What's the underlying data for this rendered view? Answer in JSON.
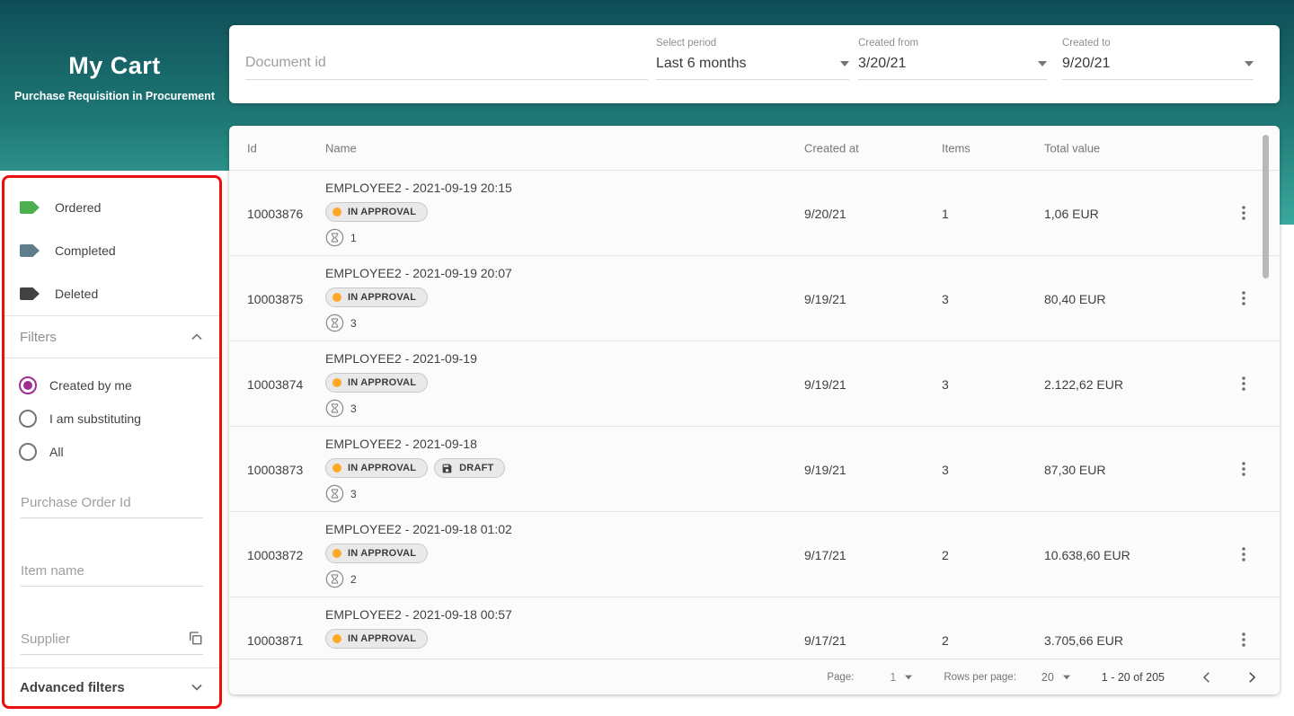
{
  "app": {
    "title": "My Cart",
    "subtitle": "Purchase Requisition in Procurement"
  },
  "sidebar": {
    "statuses": [
      {
        "label": "Ordered",
        "color": "#4caf50",
        "icon": "tag-icon"
      },
      {
        "label": "Completed",
        "color": "#607d8b",
        "icon": "tag-icon"
      },
      {
        "label": "Deleted",
        "color": "#424242",
        "icon": "tag-icon"
      }
    ],
    "filters_header": "Filters",
    "radios": [
      {
        "label": "Created by me",
        "selected": true
      },
      {
        "label": "I am substituting",
        "selected": false
      },
      {
        "label": "All",
        "selected": false
      }
    ],
    "inputs": [
      {
        "name": "purchase-order-id",
        "placeholder": "Purchase Order Id",
        "icon": null
      },
      {
        "name": "item-name",
        "placeholder": "Item name",
        "icon": null
      },
      {
        "name": "supplier",
        "placeholder": "Supplier",
        "icon": "copy-icon"
      }
    ],
    "advanced_filters_label": "Advanced filters"
  },
  "topbar": {
    "document_id_placeholder": "Document id",
    "select_period": {
      "label": "Select period",
      "value": "Last 6 months"
    },
    "created_from": {
      "label": "Created from",
      "value": "3/20/21"
    },
    "created_to": {
      "label": "Created to",
      "value": "9/20/21"
    }
  },
  "table": {
    "columns": [
      "Id",
      "Name",
      "Created at",
      "Items",
      "Total value"
    ],
    "rows": [
      {
        "id": "10003876",
        "name": "EMPLOYEE2 - 2021-09-19 20:15",
        "badges": [
          {
            "label": "IN APPROVAL",
            "icon": "dot"
          }
        ],
        "pending_approvals": "1",
        "created_at": "9/20/21",
        "items": "1",
        "total_value": "1,06 EUR"
      },
      {
        "id": "10003875",
        "name": "EMPLOYEE2 - 2021-09-19 20:07",
        "badges": [
          {
            "label": "IN APPROVAL",
            "icon": "dot"
          }
        ],
        "pending_approvals": "3",
        "created_at": "9/19/21",
        "items": "3",
        "total_value": "80,40 EUR"
      },
      {
        "id": "10003874",
        "name": "EMPLOYEE2 - 2021-09-19",
        "badges": [
          {
            "label": "IN APPROVAL",
            "icon": "dot"
          }
        ],
        "pending_approvals": "3",
        "created_at": "9/19/21",
        "items": "3",
        "total_value": "2.122,62 EUR"
      },
      {
        "id": "10003873",
        "name": "EMPLOYEE2 - 2021-09-18",
        "badges": [
          {
            "label": "IN APPROVAL",
            "icon": "dot"
          },
          {
            "label": "DRAFT",
            "icon": "save"
          }
        ],
        "pending_approvals": "3",
        "created_at": "9/19/21",
        "items": "3",
        "total_value": "87,30 EUR"
      },
      {
        "id": "10003872",
        "name": "EMPLOYEE2 - 2021-09-18 01:02",
        "badges": [
          {
            "label": "IN APPROVAL",
            "icon": "dot"
          }
        ],
        "pending_approvals": "2",
        "created_at": "9/17/21",
        "items": "2",
        "total_value": "10.638,60 EUR"
      },
      {
        "id": "10003871",
        "name": "EMPLOYEE2 - 2021-09-18 00:57",
        "badges": [
          {
            "label": "IN APPROVAL",
            "icon": "dot"
          }
        ],
        "pending_approvals": null,
        "created_at": "9/17/21",
        "items": "2",
        "total_value": "3.705,66 EUR"
      }
    ],
    "pagination": {
      "page_label": "Page:",
      "page_value": "1",
      "rows_per_page_label": "Rows per page:",
      "rows_per_page_value": "20",
      "range_text": "1 - 20 of 205"
    }
  },
  "colors": {
    "header_gradient_top": "#0f4e58",
    "header_gradient_bottom": "#3aa99e",
    "radio_selected": "#a12c93",
    "badge_dot": "#ffa726",
    "highlight_border": "#ef0e0e"
  }
}
